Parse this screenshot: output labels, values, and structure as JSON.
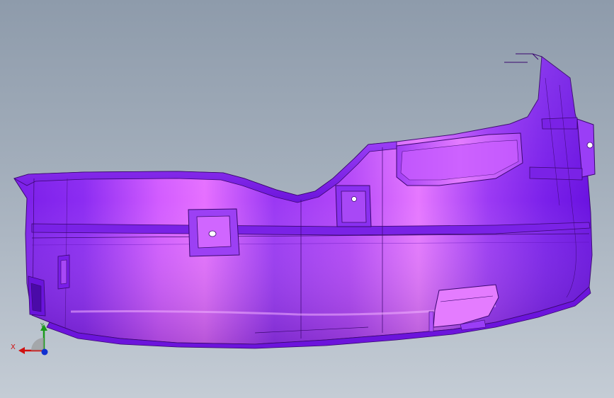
{
  "viewport": {
    "background_top": "#8e9bab",
    "background_bottom": "#c4ccd5"
  },
  "model": {
    "part_color_main": "#8a2cf0",
    "part_color_highlight": "#e06cff",
    "part_color_shadow": "#6a10d8",
    "edge_color": "#3a0870"
  },
  "triad": {
    "x_label": "X",
    "y_label": "Y",
    "x_color": "#d01010",
    "y_color": "#1a9a1a",
    "z_color": "#1030d0"
  }
}
